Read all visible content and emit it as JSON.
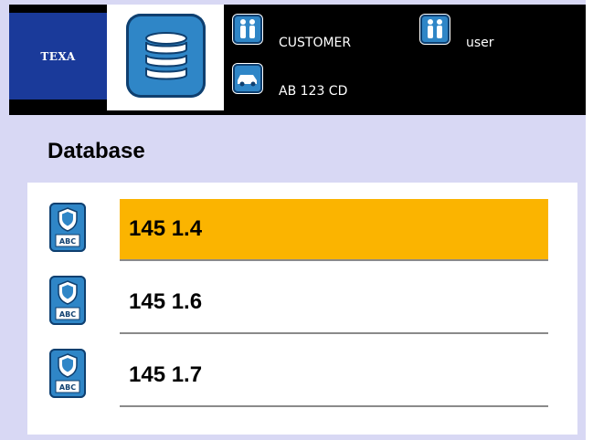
{
  "header": {
    "logo_text": "TEXA",
    "customer_label": "CUSTOMER",
    "user_label": "user",
    "plate": "AB 123 CD"
  },
  "page": {
    "title": "Database"
  },
  "list": {
    "items": [
      {
        "label": "145 1.4",
        "selected": true,
        "icon_text": "ABC"
      },
      {
        "label": "145 1.6",
        "selected": false,
        "icon_text": "ABC"
      },
      {
        "label": "145 1.7",
        "selected": false,
        "icon_text": "ABC"
      }
    ]
  },
  "colors": {
    "selected_row": "#fbb400",
    "accent": "#2f86c7",
    "background": "#d8d8f4",
    "header": "#000000"
  }
}
